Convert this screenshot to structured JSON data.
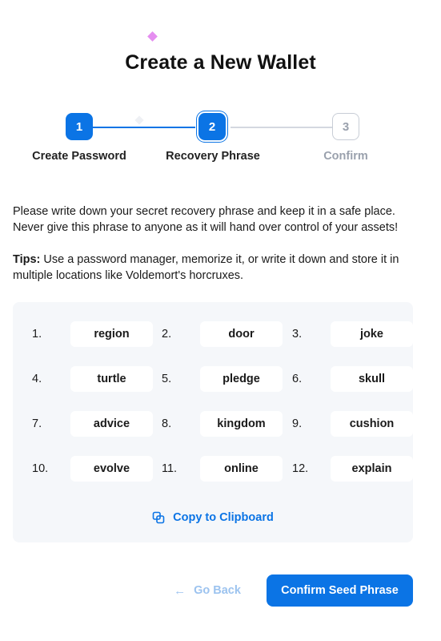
{
  "page": {
    "title": "Create a New Wallet"
  },
  "stepper": {
    "steps": [
      {
        "number": "1",
        "label": "Create Password",
        "state": "completed"
      },
      {
        "number": "2",
        "label": "Recovery Phrase",
        "state": "active"
      },
      {
        "number": "3",
        "label": "Confirm",
        "state": "pending"
      }
    ]
  },
  "instructions": {
    "paragraph": "Please write down your secret recovery phrase and keep it in a safe place. Never give this phrase to anyone as it will hand over control of your assets!",
    "tips_label": "Tips:",
    "tips_text": " Use a password manager, memorize it, or write it down and store it in multiple locations like Voldemort's horcruxes."
  },
  "seed_phrase": {
    "words": [
      {
        "num": "1.",
        "word": "region"
      },
      {
        "num": "2.",
        "word": "door"
      },
      {
        "num": "3.",
        "word": "joke"
      },
      {
        "num": "4.",
        "word": "turtle"
      },
      {
        "num": "5.",
        "word": "pledge"
      },
      {
        "num": "6.",
        "word": "skull"
      },
      {
        "num": "7.",
        "word": "advice"
      },
      {
        "num": "8.",
        "word": "kingdom"
      },
      {
        "num": "9.",
        "word": "cushion"
      },
      {
        "num": "10.",
        "word": "evolve"
      },
      {
        "num": "11.",
        "word": "online"
      },
      {
        "num": "12.",
        "word": "explain"
      }
    ],
    "copy_label": "Copy to Clipboard",
    "copy_icon": "copy-icon"
  },
  "actions": {
    "back_label": "Go Back",
    "back_icon": "arrow-left-icon",
    "confirm_label": "Confirm Seed Phrase"
  },
  "colors": {
    "accent": "#0b74e5",
    "muted": "#9aa1ad",
    "panel": "#f5f7fa"
  }
}
